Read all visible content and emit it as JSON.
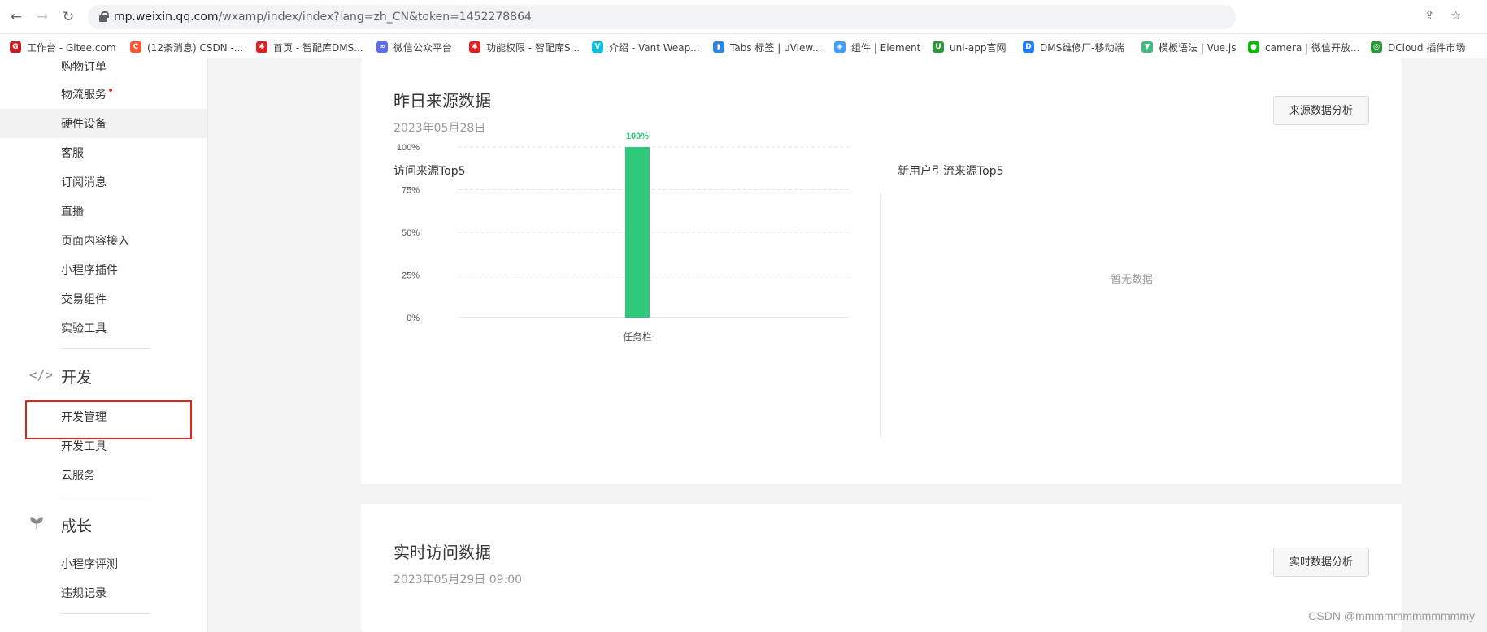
{
  "browser": {
    "url_host": "mp.weixin.qq.com",
    "url_path": "/wxamp/index/index?lang=zh_CN&token=1452278864",
    "bookmarks": [
      {
        "label": "工作台 - Gitee.com",
        "icon": "gitee-icon",
        "color": "#c71d23",
        "glyph": "G"
      },
      {
        "label": "(12条消息) CSDN -...",
        "icon": "csdn-icon",
        "color": "#fc5531",
        "glyph": "C"
      },
      {
        "label": "首页 - 智配库DMS...",
        "icon": "gear-logo-icon",
        "color": "#e02020",
        "glyph": "✱"
      },
      {
        "label": "微信公众平台",
        "icon": "wechat-mp-icon",
        "color": "#5b6cf0",
        "glyph": "∞"
      },
      {
        "label": "功能权限 - 智配库S...",
        "icon": "gear-logo-icon",
        "color": "#e02020",
        "glyph": "✱"
      },
      {
        "label": "介绍 - Vant Weap...",
        "icon": "vant-icon",
        "color": "#07c1e0",
        "glyph": "V"
      },
      {
        "label": "Tabs 标签 | uView...",
        "icon": "uview-icon",
        "color": "#2b85e4",
        "glyph": "◗"
      },
      {
        "label": "组件 | Element",
        "icon": "element-icon",
        "color": "#409eff",
        "glyph": "◈"
      },
      {
        "label": "uni-app官网",
        "icon": "uniapp-icon",
        "color": "#2b9939",
        "glyph": "U"
      },
      {
        "label": "DMS维修厂-移动端",
        "icon": "dms-icon",
        "color": "#1e80ff",
        "glyph": "D"
      },
      {
        "label": "模板语法 | Vue.js",
        "icon": "vue-icon",
        "color": "#42b883",
        "glyph": "▼"
      },
      {
        "label": "camera | 微信开放...",
        "icon": "wechat-icon",
        "color": "#09bb07",
        "glyph": "●"
      },
      {
        "label": "DCloud 插件市场",
        "icon": "dcloud-icon",
        "color": "#2b9939",
        "glyph": "◎"
      }
    ]
  },
  "sidebar": {
    "items_top": [
      "购物订单",
      "物流服务",
      "硬件设备",
      "客服",
      "订阅消息",
      "直播",
      "页面内容接入",
      "小程序插件",
      "交易组件",
      "实验工具"
    ],
    "dev_section": {
      "title": "开发",
      "icon": "code-icon",
      "items": [
        "开发管理",
        "开发工具",
        "云服务"
      ]
    },
    "growth_section": {
      "title": "成长",
      "icon": "sprout-icon",
      "items": [
        "小程序评测",
        "违规记录"
      ]
    }
  },
  "source_card": {
    "title": "昨日来源数据",
    "date": "2023年05月28日",
    "button": "来源数据分析",
    "left_heading": "访问来源Top5",
    "right_heading": "新用户引流来源Top5",
    "empty_text": "暂无数据"
  },
  "realtime_card": {
    "title": "实时访问数据",
    "date": "2023年05月29日 09:00",
    "button": "实时数据分析"
  },
  "chart_data": {
    "type": "bar",
    "categories": [
      "任务栏"
    ],
    "values": [
      100
    ],
    "data_labels": [
      "100%"
    ],
    "yticks": [
      "0%",
      "25%",
      "50%",
      "75%",
      "100%"
    ],
    "ylim": [
      0,
      100
    ],
    "color": "#2fc97b",
    "grid": true
  },
  "watermark": "CSDN @mmmmmmmmmmmmy"
}
